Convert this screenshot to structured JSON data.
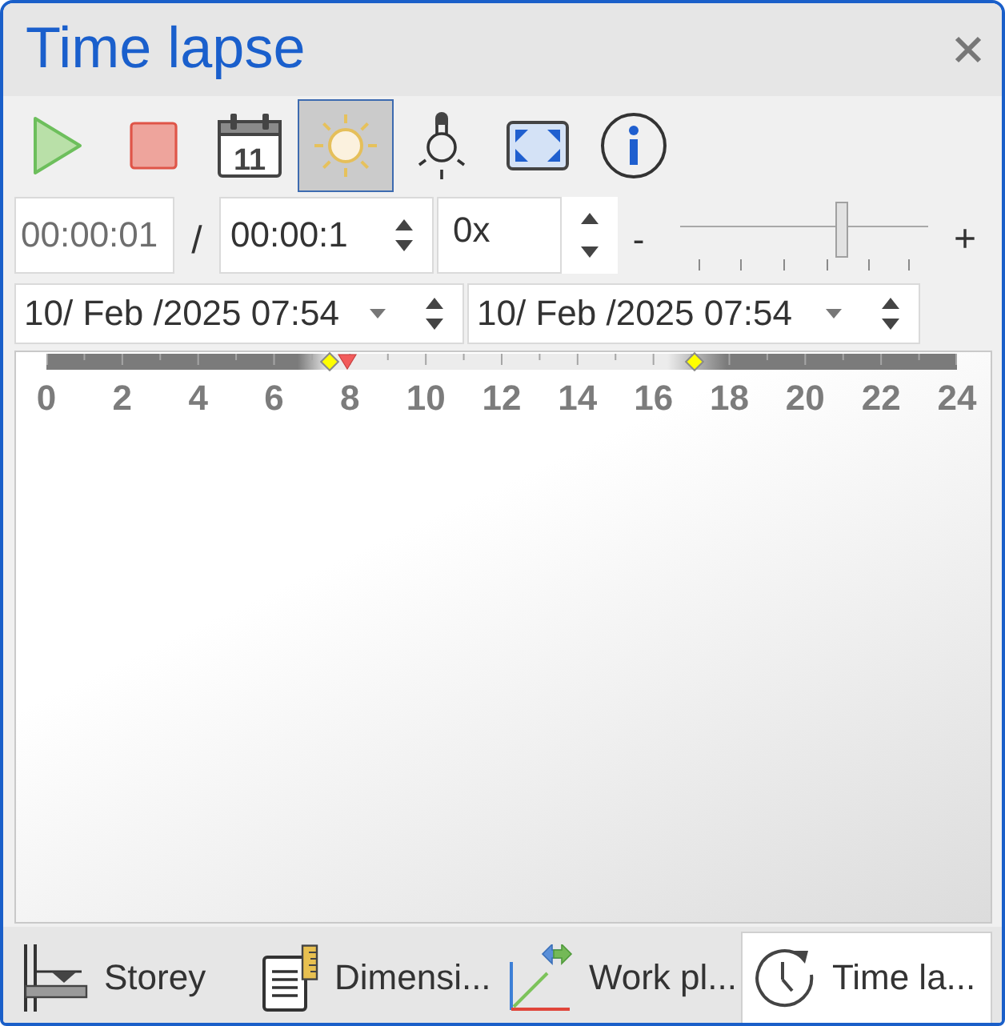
{
  "window": {
    "title": "Time lapse"
  },
  "toolbar": [
    {
      "kind": "play",
      "selected": false
    },
    {
      "kind": "stop",
      "selected": false
    },
    {
      "kind": "calendar",
      "label": "11",
      "selected": false
    },
    {
      "kind": "sun",
      "selected": true
    },
    {
      "kind": "bulb",
      "selected": false
    },
    {
      "kind": "fit",
      "selected": false
    },
    {
      "kind": "info",
      "selected": false
    }
  ],
  "playback": {
    "elapsed": {
      "value": "00:00:01",
      "disabled": true
    },
    "separator": "/",
    "duration": {
      "value": "00:00:1"
    },
    "speed": {
      "value": "0x"
    },
    "slider": {
      "minus": "-",
      "plus": "+",
      "level": 0.65
    }
  },
  "date_range": [
    {
      "value": "10/ Feb /2025 07:54"
    },
    {
      "value": "10/ Feb /2025 07:54"
    }
  ],
  "timeline": {
    "hour_labels": [
      "0",
      "2",
      "4",
      "6",
      "8",
      "10",
      "12",
      "14",
      "16",
      "18",
      "20",
      "22",
      "24"
    ],
    "markers": [
      {
        "kind": "sunrise",
        "level": 0.311
      },
      {
        "kind": "current",
        "level": 0.33
      },
      {
        "kind": "sunset",
        "level": 0.712
      }
    ]
  },
  "tabs": [
    {
      "kind": "storey",
      "label": "Storey",
      "selected": false
    },
    {
      "kind": "dimension",
      "label": "Dimensi...",
      "selected": false
    },
    {
      "kind": "work_plane",
      "label": "Work pl...",
      "selected": false
    },
    {
      "kind": "time_lapse",
      "label": "Time la...",
      "selected": true
    }
  ]
}
